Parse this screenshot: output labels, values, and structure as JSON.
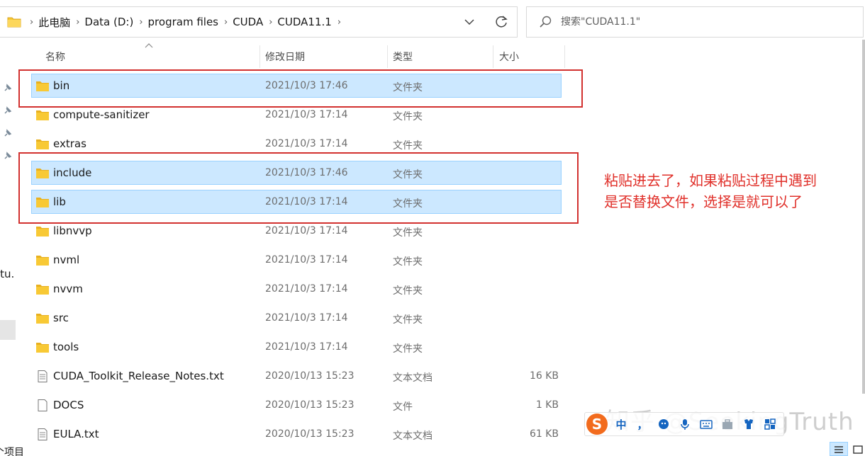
{
  "address_bar": {
    "crumbs": [
      "此电脑",
      "Data (D:)",
      "program files",
      "CUDA",
      "CUDA11.1"
    ],
    "separator": "›"
  },
  "search": {
    "placeholder": "搜索\"CUDA11.1\""
  },
  "columns": {
    "name": "名称",
    "modified": "修改日期",
    "type": "类型",
    "size": "大小"
  },
  "files": [
    {
      "name": "bin",
      "modified": "2021/10/3 17:46",
      "type": "文件夹",
      "size": "",
      "icon": "folder-icon",
      "selected": true
    },
    {
      "name": "compute-sanitizer",
      "modified": "2021/10/3 17:14",
      "type": "文件夹",
      "size": "",
      "icon": "folder-icon",
      "selected": false
    },
    {
      "name": "extras",
      "modified": "2021/10/3 17:14",
      "type": "文件夹",
      "size": "",
      "icon": "folder-icon",
      "selected": false
    },
    {
      "name": "include",
      "modified": "2021/10/3 17:46",
      "type": "文件夹",
      "size": "",
      "icon": "folder-icon",
      "selected": true
    },
    {
      "name": "lib",
      "modified": "2021/10/3 17:14",
      "type": "文件夹",
      "size": "",
      "icon": "folder-icon",
      "selected": true
    },
    {
      "name": "libnvvp",
      "modified": "2021/10/3 17:14",
      "type": "文件夹",
      "size": "",
      "icon": "folder-icon",
      "selected": false
    },
    {
      "name": "nvml",
      "modified": "2021/10/3 17:14",
      "type": "文件夹",
      "size": "",
      "icon": "folder-icon",
      "selected": false
    },
    {
      "name": "nvvm",
      "modified": "2021/10/3 17:14",
      "type": "文件夹",
      "size": "",
      "icon": "folder-icon",
      "selected": false
    },
    {
      "name": "src",
      "modified": "2021/10/3 17:14",
      "type": "文件夹",
      "size": "",
      "icon": "folder-icon",
      "selected": false
    },
    {
      "name": "tools",
      "modified": "2021/10/3 17:14",
      "type": "文件夹",
      "size": "",
      "icon": "folder-icon",
      "selected": false
    },
    {
      "name": "CUDA_Toolkit_Release_Notes.txt",
      "modified": "2020/10/13 15:23",
      "type": "文本文档",
      "size": "16 KB",
      "icon": "text-file-icon",
      "selected": false
    },
    {
      "name": "DOCS",
      "modified": "2020/10/13 15:23",
      "type": "文件",
      "size": "1 KB",
      "icon": "file-icon",
      "selected": false
    },
    {
      "name": "EULA.txt",
      "modified": "2020/10/13 15:23",
      "type": "文本文档",
      "size": "61 KB",
      "icon": "text-file-icon",
      "selected": false
    }
  ],
  "nav_pane": {
    "partial_text": "jtu.",
    "status_text": "个项目"
  },
  "annotation": {
    "line1": "粘贴进去了，如果粘贴过程中遇到",
    "line2": "是否替换文件，选择是就可以了"
  },
  "watermark": "知乎 @SeekingTruth",
  "ime": {
    "logo": "S",
    "items": [
      "中",
      "，"
    ]
  },
  "colors": {
    "selection_bg": "#cce8ff",
    "selection_border": "#99d1ff",
    "annotation_red": "#e0302a",
    "folder_yellow": "#f8c935"
  }
}
